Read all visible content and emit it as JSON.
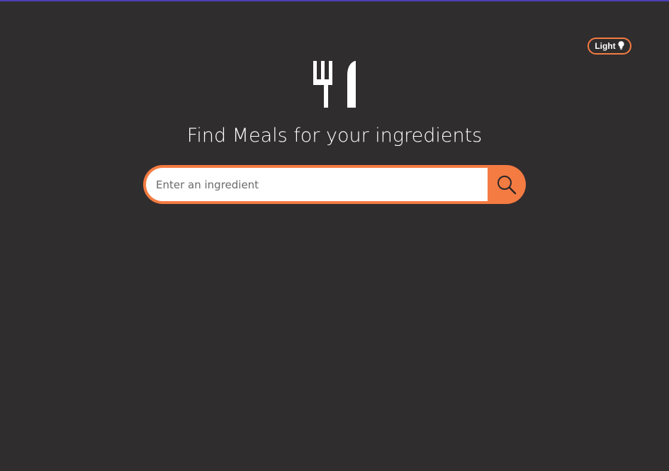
{
  "theme_toggle": {
    "label": "Light",
    "icon": "lightbulb-icon"
  },
  "logo": {
    "icon": "fork-knife-icon"
  },
  "title": "Find Meals for your ingredients",
  "search": {
    "placeholder": "Enter an ingredient",
    "value": "",
    "button_icon": "search-icon"
  },
  "colors": {
    "background": "#302d2e",
    "accent": "#f47b42",
    "text": "#ffffff"
  }
}
